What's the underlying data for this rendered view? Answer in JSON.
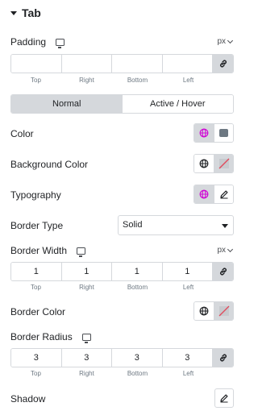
{
  "section": {
    "title": "Tab"
  },
  "padding": {
    "label": "Padding",
    "unit": "px",
    "values": [
      "",
      "",
      "",
      ""
    ]
  },
  "dim_labels": [
    "Top",
    "Right",
    "Bottom",
    "Left"
  ],
  "tabs": [
    "Normal",
    "Active / Hover"
  ],
  "color": {
    "label": "Color"
  },
  "background_color": {
    "label": "Background Color"
  },
  "typography": {
    "label": "Typography"
  },
  "border_type": {
    "label": "Border Type",
    "value": "Solid"
  },
  "border_width": {
    "label": "Border Width",
    "unit": "px",
    "values": [
      "1",
      "1",
      "1",
      "1"
    ]
  },
  "border_color": {
    "label": "Border Color"
  },
  "border_radius": {
    "label": "Border Radius",
    "values": [
      "3",
      "3",
      "3",
      "3"
    ]
  },
  "shadow": {
    "label": "Shadow"
  },
  "colors": {
    "accent": "#d004d4",
    "control_bg": "#d5d8dc",
    "swatch": "#6d7882",
    "clear": "#e2485a"
  }
}
